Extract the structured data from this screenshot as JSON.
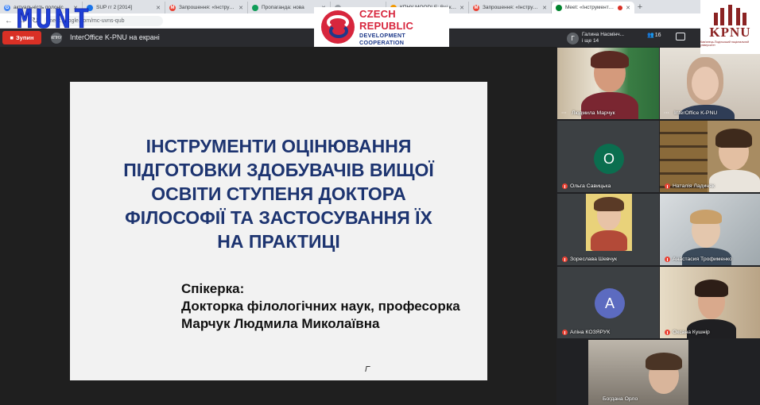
{
  "watermark": "MUNT",
  "browser": {
    "tabs": [
      {
        "label": "актуальність полоністики",
        "favicon_color": "#4285f4",
        "favicon_glyph": "G",
        "active": false
      },
      {
        "label": "SUP гг 2 [2014]",
        "favicon_color": "#1a73e8",
        "favicon_glyph": "",
        "active": false
      },
      {
        "label": "Запрошення: «Інструменти",
        "favicon_color": "#ea4335",
        "favicon_glyph": "M",
        "active": false
      },
      {
        "label": "Пропаганда: нова",
        "favicon_color": "#0f9d58",
        "favicon_glyph": "",
        "active": false
      },
      {
        "label": "",
        "favicon_color": "#9aa0a6",
        "favicon_glyph": "",
        "active": false
      },
      {
        "label": "КПНУ MOODLE: Всі курси",
        "favicon_color": "#f29900",
        "favicon_glyph": "",
        "active": false
      },
      {
        "label": "Запрошення: «Інструменти",
        "favicon_color": "#ea4335",
        "favicon_glyph": "M",
        "active": false
      },
      {
        "label": "Meet: «Інструменти о",
        "favicon_color": "#00832d",
        "favicon_glyph": "",
        "active": true
      }
    ],
    "url": "meet.google.com/mc-uvns-qub"
  },
  "meet": {
    "stop_button": "Зупин",
    "presenter_avatar": "КПНУ",
    "presenting_label": "InterOffice K-PNU на екрані",
    "participants_summary": {
      "avatar_letter": "Г",
      "line1": "Галина Насмінч...",
      "line2": "і ще 14"
    },
    "participant_count": "16"
  },
  "logos": {
    "czech_line1": "CZECH REPUBLIC",
    "czech_line2": "DEVELOPMENT COOPERATION",
    "kpnu_text": "KPNU",
    "kpnu_sub": "Кам'янець-Подільський національний університет"
  },
  "slide": {
    "title_lines": [
      "ІНСТРУМЕНТИ ОЦІНЮВАННЯ",
      "ПІДГОТОВКИ ЗДОБУВАЧІВ ВИЩОЇ",
      "ОСВІТИ СТУПЕНЯ  ДОКТОРА",
      "ФІЛОСОФІЇ   ТА ЗАСТОСУВАННЯ ЇХ",
      "НА ПРАКТИЦІ"
    ],
    "speaker_lines": [
      "Спікерка:",
      "Докторка філологічних наук, професорка",
      "Марчук Людмила Миколаївна"
    ]
  },
  "tiles": [
    {
      "name": "Людмила Марчук",
      "type": "video",
      "muted": false
    },
    {
      "name": "InterOffice K-PNU",
      "type": "video",
      "muted": false
    },
    {
      "name": "Ольга Савицька",
      "type": "avatar",
      "letter": "О",
      "avatar_color": "#0b6e4f",
      "muted": true
    },
    {
      "name": "Наталія Ладиняк",
      "type": "video",
      "muted": true
    },
    {
      "name": "Зореслава Шевчук",
      "type": "video",
      "muted": true
    },
    {
      "name": "Анастасия Трофименко",
      "type": "video",
      "muted": true
    },
    {
      "name": "Аліна КОЗЯРУК",
      "type": "avatar",
      "letter": "А",
      "avatar_color": "#5c6bc0",
      "muted": true
    },
    {
      "name": "Оксана Кушнір",
      "type": "video",
      "muted": true
    },
    {
      "name": "Богдана Орло",
      "type": "video",
      "muted": false
    }
  ]
}
